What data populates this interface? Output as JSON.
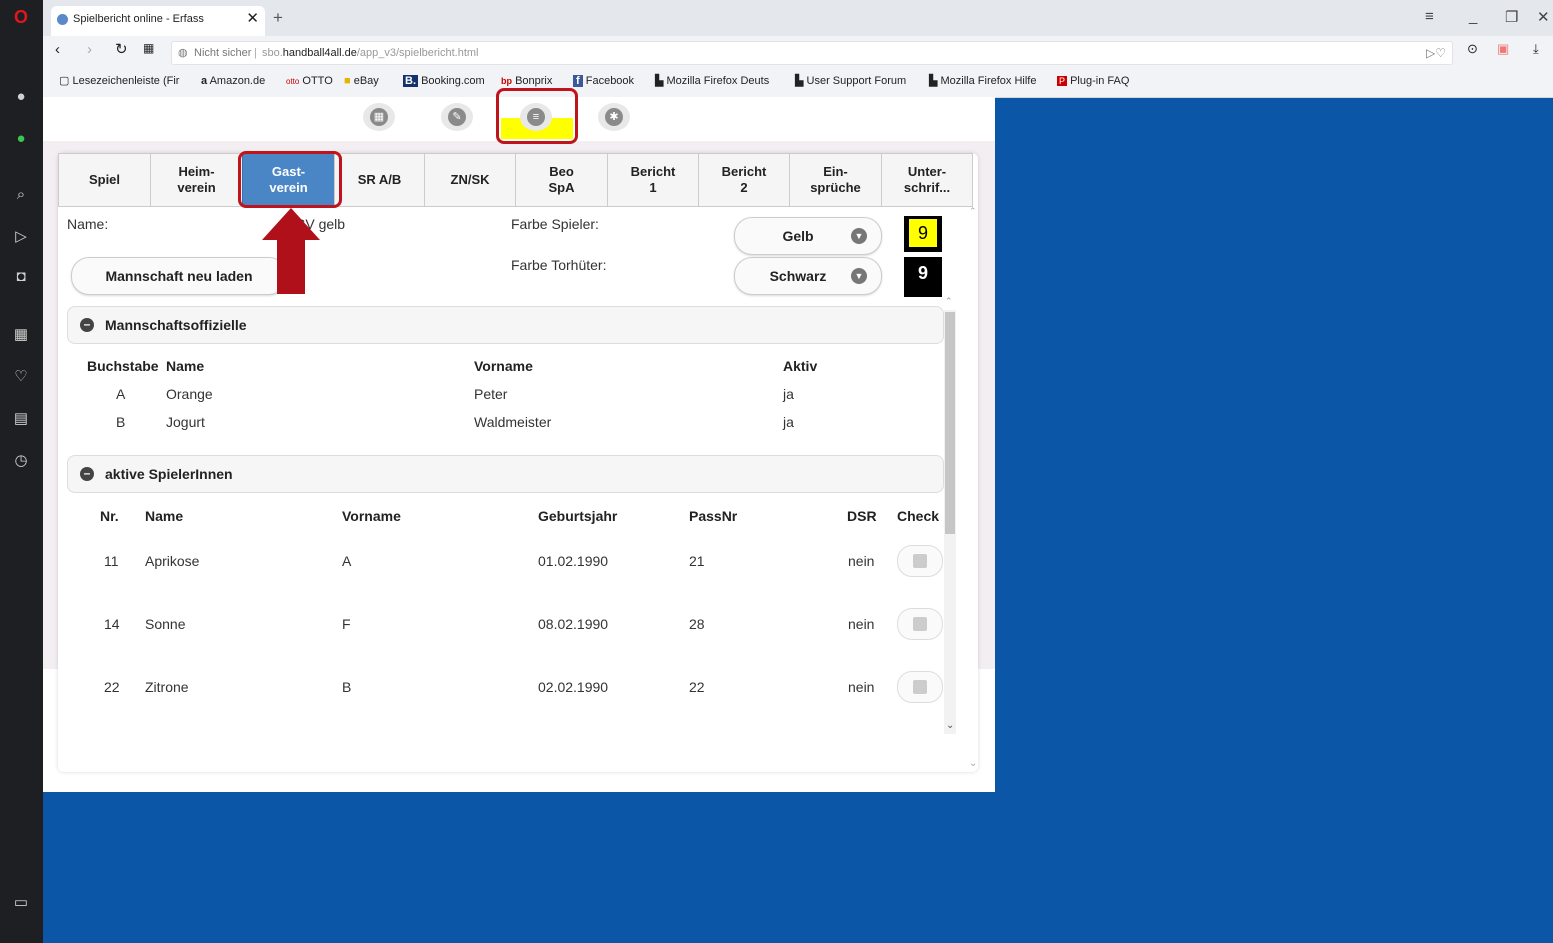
{
  "browser": {
    "tab_title": "Spielbericht online - Erfass",
    "tab_close": "✕",
    "new_tab": "+",
    "address_security": "Nicht sicher",
    "address_prefix": "sbo.",
    "address_domain": "handball4all.de",
    "address_path": "/app_v3/spielbericht.html",
    "bookmarks": [
      "Lesezeichenleiste (Fir",
      "Amazon.de",
      "OTTO",
      "eBay",
      "Booking.com",
      "Bonprix",
      "Facebook",
      "Mozilla Firefox Deuts",
      "User Support Forum",
      "Mozilla Firefox Hilfe",
      "Plug-in FAQ"
    ]
  },
  "tabs": [
    {
      "label": "Spiel"
    },
    {
      "label": "Heim-\nverein"
    },
    {
      "label": "Gast-\nverein"
    },
    {
      "label": "SR A/B"
    },
    {
      "label": "ZN/SK"
    },
    {
      "label": "Beo\nSpA"
    },
    {
      "label": "Bericht\n1"
    },
    {
      "label": "Bericht\n2"
    },
    {
      "label": "Ein-\nsprüche"
    },
    {
      "label": "Unter-\nschrif..."
    }
  ],
  "team": {
    "name_label": "Name:",
    "name_value": "SV gelb",
    "reload_button": "Mannschaft neu laden",
    "player_color_label": "Farbe Spieler:",
    "player_color_value": "Gelb",
    "player_color_badge": "9",
    "keeper_color_label": "Farbe Torhüter:",
    "keeper_color_value": "Schwarz",
    "keeper_color_badge": "9",
    "colors": {
      "player": "#ffff00",
      "keeper": "#000000",
      "active_tab": "#4a86c6",
      "highlight": "#c0141c"
    }
  },
  "officials": {
    "title": "Mannschaftsoffizielle",
    "headers": [
      "Buchstabe",
      "Name",
      "Vorname",
      "Aktiv"
    ],
    "rows": [
      {
        "letter": "A",
        "name": "Orange",
        "first": "Peter",
        "active": "ja"
      },
      {
        "letter": "B",
        "name": "Jogurt",
        "first": "Waldmeister",
        "active": "ja"
      }
    ]
  },
  "players": {
    "title": "aktive SpielerInnen",
    "headers": [
      "Nr.",
      "Name",
      "Vorname",
      "Geburtsjahr",
      "PassNr",
      "DSR",
      "Check"
    ],
    "rows": [
      {
        "nr": "11",
        "name": "Aprikose",
        "first": "A",
        "birth": "01.02.1990",
        "pass": "21",
        "dsr": "nein"
      },
      {
        "nr": "14",
        "name": "Sonne",
        "first": "F",
        "birth": "08.02.1990",
        "pass": "28",
        "dsr": "nein"
      },
      {
        "nr": "22",
        "name": "Zitrone",
        "first": "B",
        "birth": "02.02.1990",
        "pass": "22",
        "dsr": "nein"
      }
    ]
  }
}
